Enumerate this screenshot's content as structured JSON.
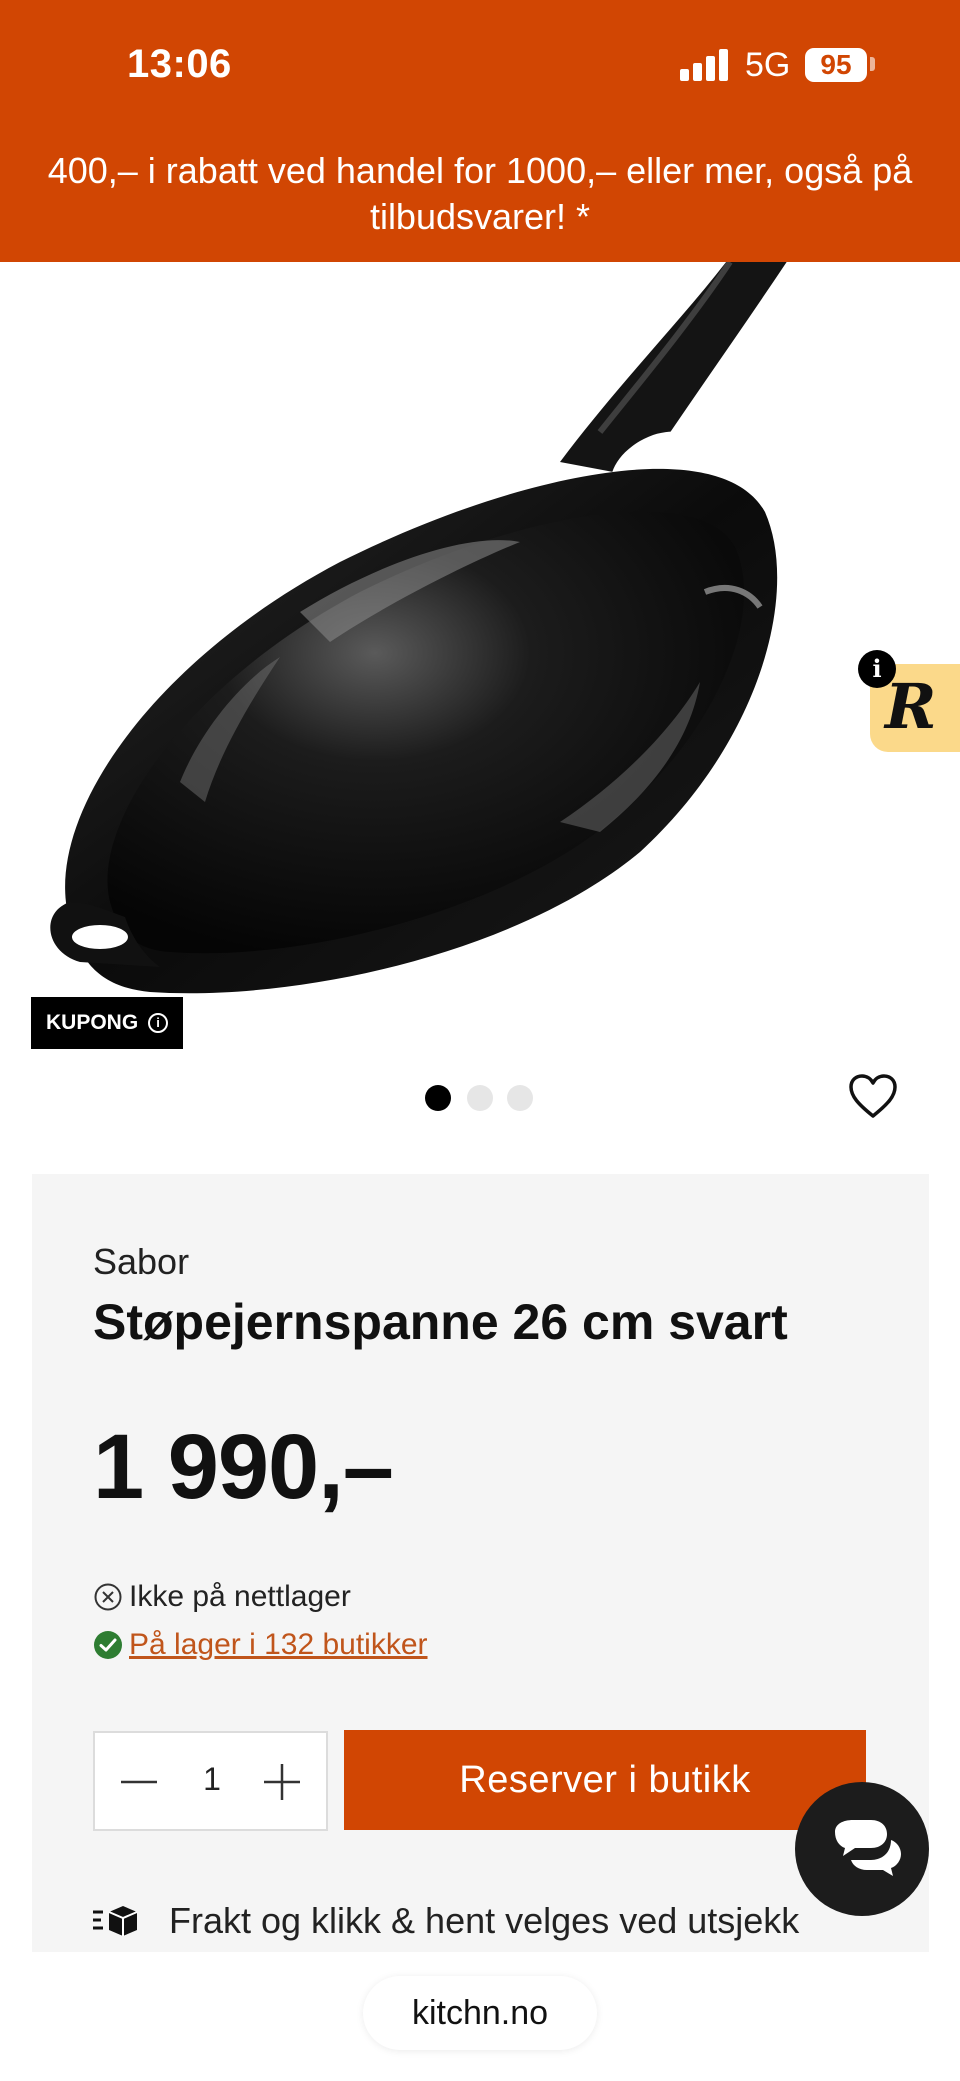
{
  "status_bar": {
    "time": "13:06",
    "network": "5G",
    "battery": "95"
  },
  "promo": {
    "text": "400,– i rabatt ved handel for 1000,– eller mer, også på tilbudsvarer! *"
  },
  "gallery": {
    "coupon_label": "KUPONG",
    "dots": 3,
    "active_dot": 0
  },
  "product": {
    "brand": "Sabor",
    "name": "Støpejernspanne 26 cm svart",
    "price": "1 990,–"
  },
  "stock": {
    "online": "Ikke på nettlager",
    "stores": "På lager i 132 butikker"
  },
  "cart": {
    "quantity": "1",
    "reserve_label": "Reserver i butikk"
  },
  "shipping": {
    "text": "Frakt og klikk & hent velges ved utsjekk"
  },
  "browser": {
    "url": "kitchn.no"
  },
  "colors": {
    "brand": "#d14603",
    "stock_ok": "#2e7d32",
    "link": "#c0551b"
  }
}
